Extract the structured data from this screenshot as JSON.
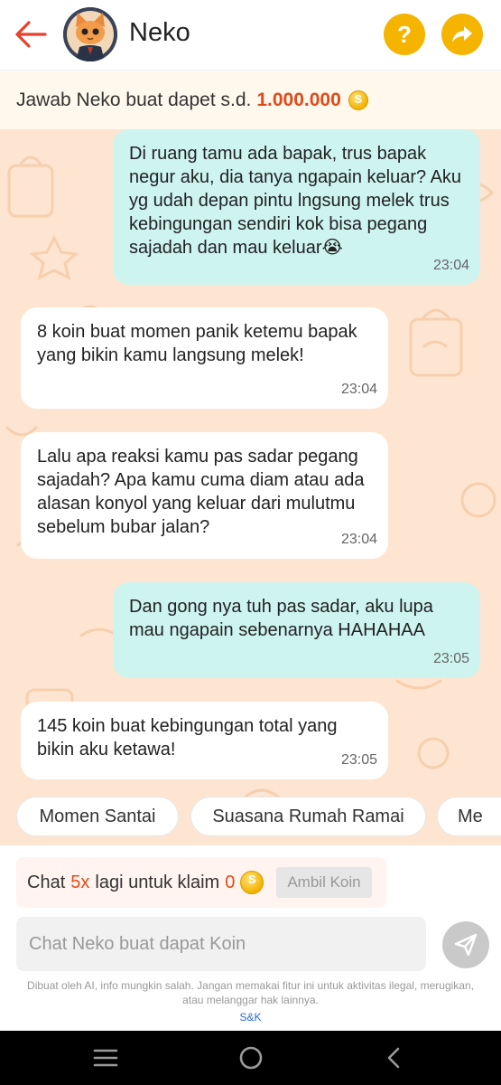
{
  "header": {
    "title": "Neko",
    "back_icon": "arrow-left-icon",
    "help_label": "?",
    "share_icon": "share-arrow-icon",
    "accent": "#f5b400",
    "back_color": "#e8412c"
  },
  "reward": {
    "text": "Jawab Neko buat dapet s.d.",
    "amount": "1.000.000",
    "icon": "coin-icon"
  },
  "messages": [
    {
      "from": "me",
      "text": "Di ruang tamu ada bapak, trus bapak negur aku, dia tanya ngapain keluar? Aku yg udah depan pintu lngsung melek trus kebingungan sendiri kok bisa pegang sajadah dan mau keluar😭",
      "time": "23:04"
    },
    {
      "from": "bot",
      "text": "8 koin buat momen panik ketemu bapak yang bikin kamu langsung melek!",
      "time": "23:04"
    },
    {
      "from": "bot",
      "text": "Lalu apa reaksi kamu pas sadar pegang sajadah? Apa kamu cuma diam atau ada alasan konyol yang keluar dari mulutmu sebelum bubar jalan?",
      "time": "23:04"
    },
    {
      "from": "me",
      "text": "Dan gong nya tuh pas sadar, aku lupa mau ngapain sebenarnya HAHAHAA",
      "time": "23:05"
    },
    {
      "from": "bot",
      "text": "145 koin buat kebingungan total yang bikin aku ketawa!",
      "time": "23:05"
    }
  ],
  "suggestions": [
    "Momen Santai",
    "Suasana Rumah Ramai",
    "Me"
  ],
  "claim": {
    "prefix": "Chat",
    "count": "5x",
    "middle": "lagi untuk klaim",
    "coins": "0",
    "button": "Ambil Koin"
  },
  "input": {
    "placeholder": "Chat Neko buat dapat Koin",
    "value": ""
  },
  "disclaimer": "Dibuat oleh AI, info mungkin salah. Jangan memakai fitur ini untuk aktivitas ilegal, merugikan, atau melanggar hak lainnya.",
  "link": "S&K",
  "nav": {
    "menu_icon": "menu-icon",
    "home_icon": "home-circle-icon",
    "back_icon": "back-chevron-icon"
  }
}
